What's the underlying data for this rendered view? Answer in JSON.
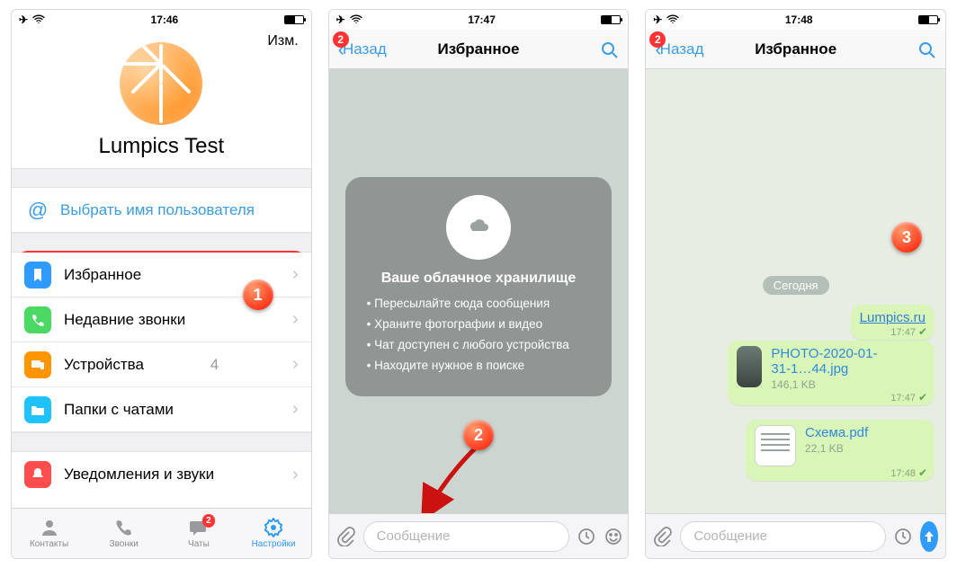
{
  "phone1": {
    "status": {
      "time": "17:46"
    },
    "edit": "Изм.",
    "profile_name": "Lumpics Test",
    "username_row": "Выбрать имя пользователя",
    "rows": {
      "fav": "Избранное",
      "recent": "Недавние звонки",
      "devices": "Устройства",
      "devices_count": "4",
      "folders": "Папки с чатами",
      "notif": "Уведомления и звуки"
    },
    "tabs": {
      "contacts": "Контакты",
      "calls": "Звонки",
      "chats": "Чаты",
      "chats_badge": "2",
      "settings": "Настройки"
    }
  },
  "phone2": {
    "status": {
      "time": "17:47"
    },
    "back": "Назад",
    "back_badge": "2",
    "title": "Избранное",
    "cloud": {
      "heading": "Ваше облачное хранилище",
      "b1": "Пересылайте сюда сообщения",
      "b2": "Храните фотографии и видео",
      "b3": "Чат доступен с любого устройства",
      "b4": "Находите нужное в поиске"
    },
    "input_placeholder": "Сообщение"
  },
  "phone3": {
    "status": {
      "time": "17:48"
    },
    "back": "Назад",
    "back_badge": "2",
    "title": "Избранное",
    "date": "Сегодня",
    "msg_link": {
      "text": "Lumpics.ru",
      "time": "17:47"
    },
    "msg_photo": {
      "name": "PHOTO-2020-01-31-1…44.jpg",
      "size": "146,1 KB",
      "time": "17:47"
    },
    "msg_doc": {
      "name": "Схема.pdf",
      "size": "22,1 KB",
      "time": "17:48"
    },
    "input_placeholder": "Сообщение"
  },
  "markers": {
    "m1": "1",
    "m2": "2",
    "m3": "3"
  }
}
